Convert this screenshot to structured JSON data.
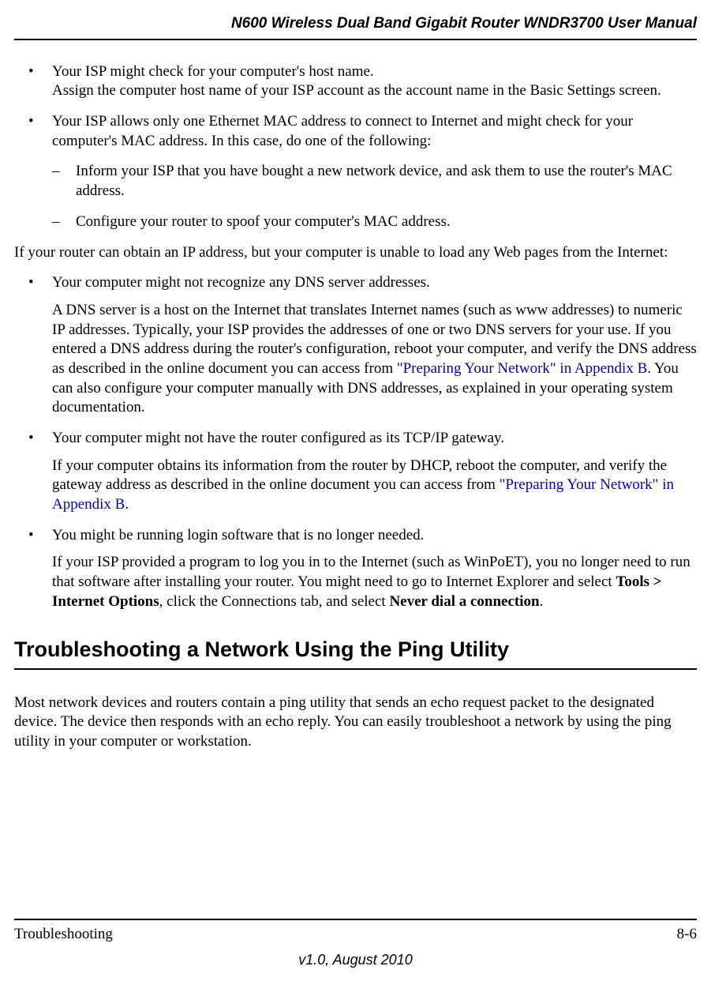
{
  "header": {
    "title": "N600 Wireless Dual Band Gigabit Router WNDR3700 User Manual"
  },
  "bullets": {
    "b1_line1": "Your ISP might check for your computer's host name.",
    "b1_line2": "Assign the computer host name of your ISP account as the account name in the Basic Settings screen.",
    "b2": "Your ISP allows only one Ethernet MAC address to connect to Internet and might check for your computer's MAC address. In this case, do one of the following:",
    "d1": "Inform your ISP that you have bought a new network device, and ask them to use the router's MAC address.",
    "d2": "Configure your router to spoof your computer's MAC address."
  },
  "para1": "If your router can obtain an IP address, but your computer is unable to load any Web pages from the Internet:",
  "bullets2": {
    "b3": "Your computer might not recognize any DNS server addresses.",
    "b3_sub_before": "A DNS server is a host on the Internet that translates Internet names (such as www addresses) to numeric IP addresses. Typically, your ISP provides the addresses of one or two DNS servers for your use. If you entered a DNS address during the router's configuration, reboot your computer, and verify the DNS address as described in the online document you can access from ",
    "b3_link": "\"Preparing Your Network\" in Appendix B",
    "b3_sub_after": ". You can also configure your computer manually with DNS addresses, as explained in your operating system documentation.",
    "b4": "Your computer might not have the router configured as its TCP/IP gateway.",
    "b4_sub_before": "If your computer obtains its information from the router by DHCP, reboot the computer, and verify the gateway address as described in the online document you can access from ",
    "b4_link": "\"Preparing Your Network\" in Appendix B",
    "b4_sub_after": ".",
    "b5": "You might be running login software that is no longer needed.",
    "b5_sub_before": "If your ISP provided a program to log you in to the Internet (such as WinPoET), you no longer need to run that software after installing your router. You might need to go to Internet Explorer and select ",
    "b5_bold1": "Tools > Internet Options",
    "b5_mid": ", click the Connections tab, and select ",
    "b5_bold2": "Never dial a connection",
    "b5_after": "."
  },
  "section_heading": "Troubleshooting a Network Using the Ping Utility",
  "section_para": "Most network devices and routers contain a ping utility that sends an echo request packet to the designated device. The device then responds with an echo reply. You can easily troubleshoot a network by using the ping utility in your computer or workstation.",
  "footer": {
    "left": "Troubleshooting",
    "right": "8-6",
    "version": "v1.0, August 2010"
  }
}
